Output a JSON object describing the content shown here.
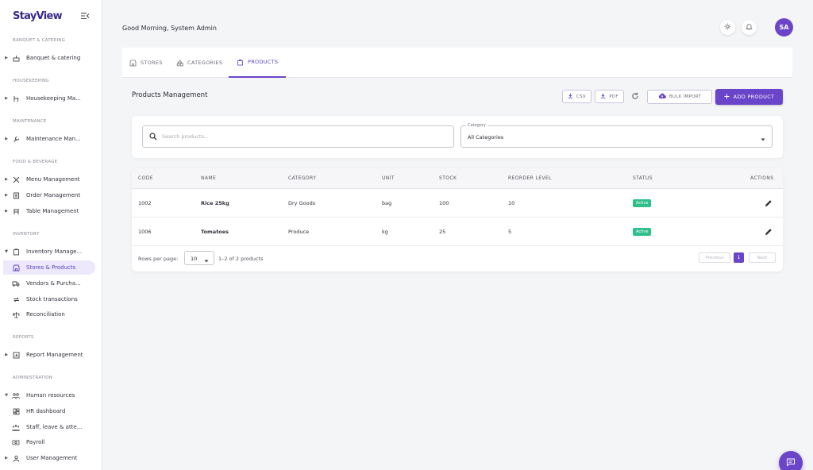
{
  "app": {
    "logo_part1": "Stay",
    "logo_part2": "View"
  },
  "sidebar": {
    "sections": {
      "banquet": "BANQUET & CATERING",
      "housekeeping": "HOUSEKEEPING",
      "maintenance": "MAINTENANCE",
      "food": "FOOD & BEVERAGE",
      "inventory": "INVENTORY",
      "reports": "REPORTS",
      "administration": "ADMINISTRATION"
    },
    "items": {
      "banquet_catering": "Banquet & catering",
      "housekeeping_mgmt": "Housekeeping Ma...",
      "maintenance_mgmt": "Maintenance Man...",
      "menu_mgmt": "Menu Management",
      "order_mgmt": "Order Management",
      "table_mgmt": "Table Management",
      "inventory_mgmt": "Inventory Manage...",
      "stores_products": "Stores & Products",
      "vendors_purchases": "Vendors & Purcha...",
      "stock_transactions": "Stock transactions",
      "reconciliation": "Reconciliation",
      "report_mgmt": "Report Management",
      "human_resources": "Human resources",
      "hr_dashboard": "HR dashboard",
      "staff_leave": "Staff, leave & atte...",
      "payroll": "Payroll",
      "user_mgmt": "User Management"
    }
  },
  "header": {
    "greeting": "Good Morning, System Admin",
    "avatar_initials": "SA"
  },
  "tabs": {
    "stores": "STORES",
    "categories": "CATEGORIES",
    "products": "PRODUCTS"
  },
  "page": {
    "title": "Products Management",
    "csv_label": "CSV",
    "pdf_label": "PDF",
    "bulk_import_label": "BULK IMPORT",
    "add_product_label": "ADD PRODUCT"
  },
  "filters": {
    "search_placeholder": "Search products...",
    "category_label": "Category",
    "category_value": "All Categories"
  },
  "table": {
    "headers": {
      "code": "CODE",
      "name": "NAME",
      "category": "CATEGORY",
      "unit": "UNIT",
      "stock": "STOCK",
      "reorder": "REORDER LEVEL",
      "status": "STATUS",
      "actions": "ACTIONS"
    },
    "rows": [
      {
        "code": "1002",
        "name": "Rice 25kg",
        "category": "Dry Goods",
        "unit": "bag",
        "stock": "100",
        "reorder": "10",
        "status": "Active"
      },
      {
        "code": "1006",
        "name": "Tomatoes",
        "category": "Produce",
        "unit": "kg",
        "stock": "25",
        "reorder": "5",
        "status": "Active"
      }
    ],
    "footer": {
      "rows_per_page_label": "Rows per page:",
      "rows_per_page_value": "10",
      "range": "1–2 of 2 products",
      "previous": "Previous",
      "page": "1",
      "next": "Next"
    }
  },
  "colors": {
    "accent": "#6b45c9",
    "active_badge": "#2fbf8a",
    "active_nav_bg": "#ede8fb"
  }
}
